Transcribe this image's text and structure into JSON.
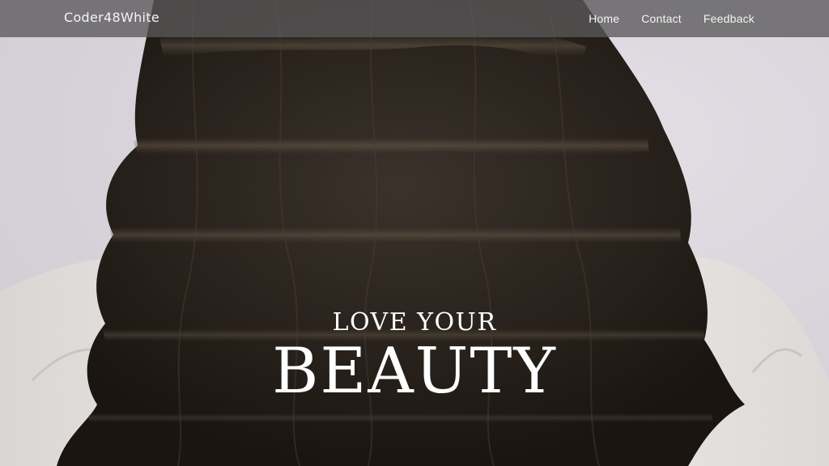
{
  "navbar": {
    "brand": "Coder48White",
    "links": [
      {
        "label": "Home"
      },
      {
        "label": "Contact"
      },
      {
        "label": "Feedback"
      }
    ]
  },
  "hero": {
    "line1": "LOVE YOUR",
    "line2": "BEAUTY",
    "image": "long dark wavy hair from behind, white shirt"
  },
  "colors": {
    "navbar_bg": "#5a585a",
    "hero_text": "#ffffff",
    "hair": "#2e2822",
    "shirt": "#eeecea"
  }
}
